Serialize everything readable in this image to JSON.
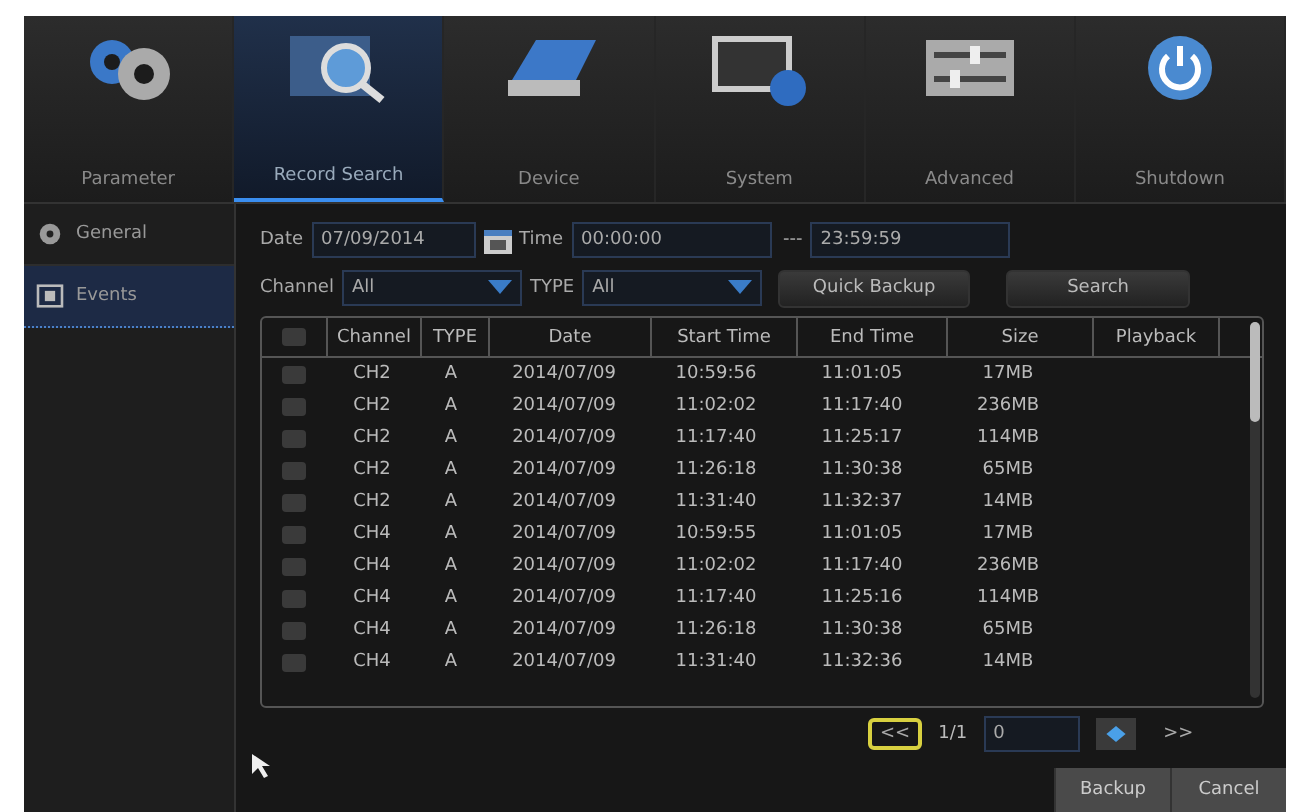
{
  "tabs": [
    {
      "label": "Parameter",
      "selected": false,
      "kind": "gears"
    },
    {
      "label": "Record Search",
      "selected": true,
      "kind": "search"
    },
    {
      "label": "Device",
      "selected": false,
      "kind": "disk"
    },
    {
      "label": "System",
      "selected": false,
      "kind": "info"
    },
    {
      "label": "Advanced",
      "selected": false,
      "kind": "sliders"
    },
    {
      "label": "Shutdown",
      "selected": false,
      "kind": "power"
    }
  ],
  "sidebar": {
    "items": [
      {
        "label": "General",
        "selected": false,
        "kind": "film"
      },
      {
        "label": "Events",
        "selected": true,
        "kind": "event"
      }
    ]
  },
  "filters": {
    "date_label": "Date",
    "date": "07/09/2014",
    "time_label": "Time",
    "time_from": "00:00:00",
    "separator": "---",
    "time_to": "23:59:59",
    "channel_label": "Channel",
    "channel": "All",
    "type_label": "TYPE",
    "type": "All",
    "quick_backup": "Quick Backup",
    "search": "Search"
  },
  "table": {
    "all_checked": false,
    "columns": [
      "Channel",
      "TYPE",
      "Date",
      "Start Time",
      "End Time",
      "Size",
      "Playback"
    ],
    "rows": [
      {
        "checked": false,
        "cells": [
          "CH2",
          "A",
          "2014/07/09",
          "10:59:56",
          "11:01:05",
          "17MB"
        ]
      },
      {
        "checked": false,
        "cells": [
          "CH2",
          "A",
          "2014/07/09",
          "11:02:02",
          "11:17:40",
          "236MB"
        ]
      },
      {
        "checked": false,
        "cells": [
          "CH2",
          "A",
          "2014/07/09",
          "11:17:40",
          "11:25:17",
          "114MB"
        ]
      },
      {
        "checked": false,
        "cells": [
          "CH2",
          "A",
          "2014/07/09",
          "11:26:18",
          "11:30:38",
          "65MB"
        ]
      },
      {
        "checked": false,
        "cells": [
          "CH2",
          "A",
          "2014/07/09",
          "11:31:40",
          "11:32:37",
          "14MB"
        ]
      },
      {
        "checked": false,
        "cells": [
          "CH4",
          "A",
          "2014/07/09",
          "10:59:55",
          "11:01:05",
          "17MB"
        ]
      },
      {
        "checked": false,
        "cells": [
          "CH4",
          "A",
          "2014/07/09",
          "11:02:02",
          "11:17:40",
          "236MB"
        ]
      },
      {
        "checked": false,
        "cells": [
          "CH4",
          "A",
          "2014/07/09",
          "11:17:40",
          "11:25:16",
          "114MB"
        ]
      },
      {
        "checked": false,
        "cells": [
          "CH4",
          "A",
          "2014/07/09",
          "11:26:18",
          "11:30:38",
          "65MB"
        ]
      },
      {
        "checked": false,
        "cells": [
          "CH4",
          "A",
          "2014/07/09",
          "11:31:40",
          "11:32:36",
          "14MB"
        ]
      }
    ]
  },
  "pager": {
    "first": "<<",
    "page": "1/1",
    "page_input": "0",
    "last": ">>"
  },
  "buttons": [
    "Backup",
    "Cancel"
  ]
}
